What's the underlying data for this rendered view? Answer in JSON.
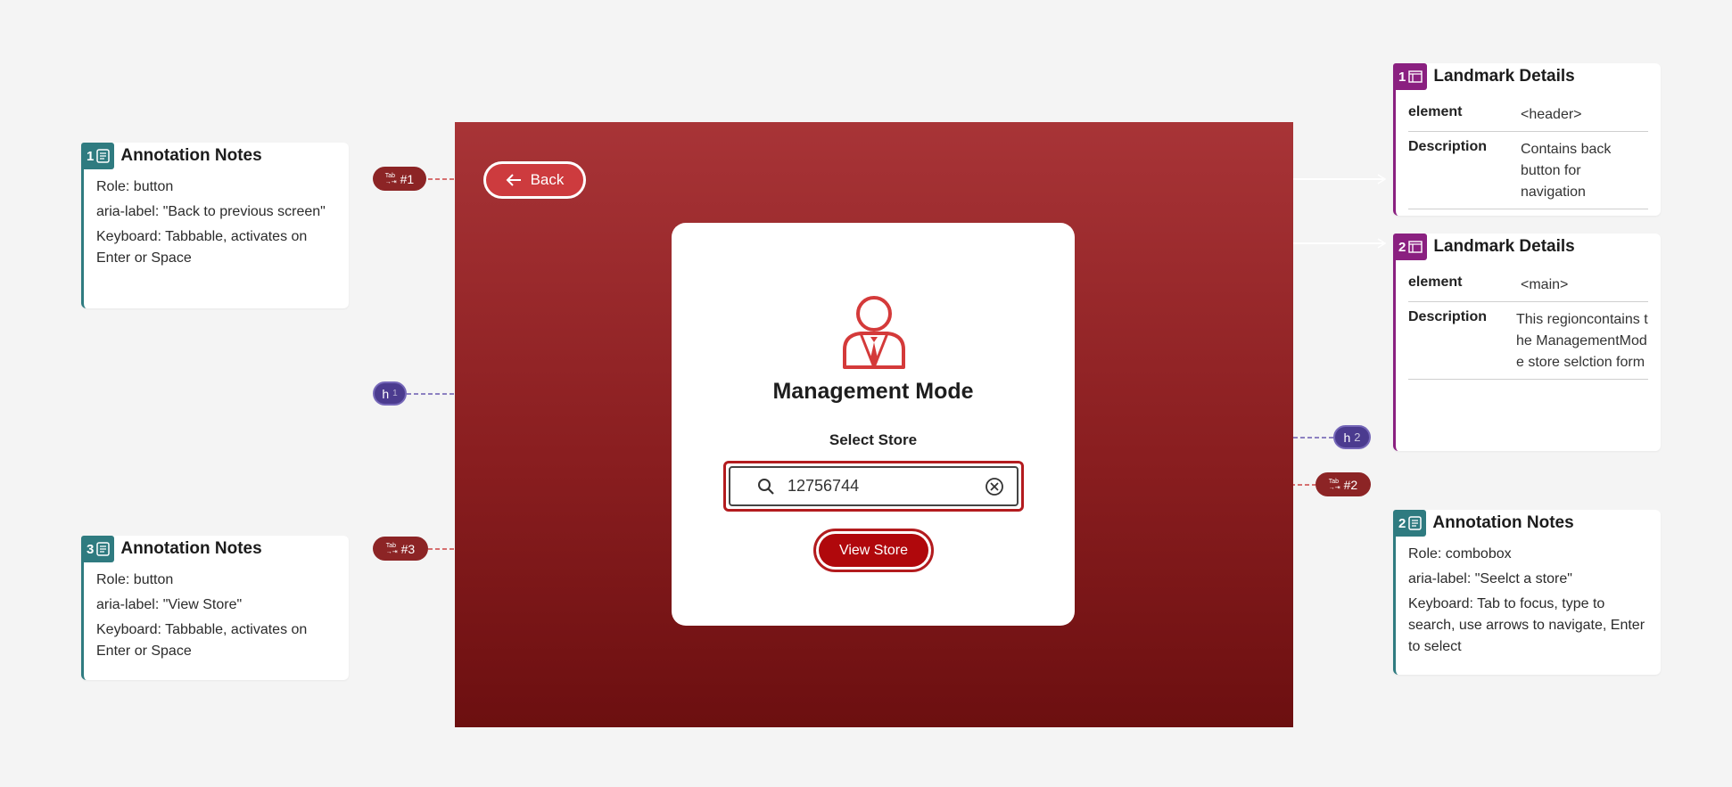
{
  "notes": [
    {
      "number": "1",
      "title": "Annotation Notes",
      "role": "Role: button",
      "aria": "aria-label: \"Back to previous screen\"",
      "keyboard": "Keyboard: Tabbable, activates on Enter or Space"
    },
    {
      "number": "3",
      "title": "Annotation Notes",
      "role": "Role: button",
      "aria": "aria-label: \"View Store\"",
      "keyboard": "Keyboard: Tabbable, activates on Enter or Space"
    },
    {
      "number": "2",
      "title": "Annotation Notes",
      "role": "Role: combobox",
      "aria": "aria-label: \"Seelct a store\"",
      "keyboard": "Keyboard: Tab to focus, type to search, use arrows to navigate, Enter to select"
    }
  ],
  "landmarks": [
    {
      "number": "1",
      "title": "Landmark Details",
      "element_key": "element",
      "element_val": "<header>",
      "desc_key": "Description",
      "desc_val": "Contains back button for navigation"
    },
    {
      "number": "2",
      "title": "Landmark Details",
      "element_key": "element",
      "element_val": "<main>",
      "desc_key": "Description",
      "desc_val": "This regioncontains the ManagementMode store selction form"
    }
  ],
  "app": {
    "back_label": "Back",
    "heading": "Management Mode",
    "select_label": "Select Store",
    "search_value": "12756744",
    "view_button": "View Store"
  },
  "markers": {
    "tab_word": "Tab",
    "tab1": "#1",
    "tab2": "#2",
    "tab3": "#3",
    "h1": "h",
    "h1_level": "1",
    "h2": "h",
    "h2_level": "2"
  },
  "colors": {
    "screen_gradient": [
      "#a83437",
      "#6c0f10"
    ],
    "accent_red": "#b0080c",
    "note_teal": "#2f7b80",
    "landmark_purple": "#8a2080",
    "heading_marker": "#4b3b8f"
  },
  "icons": [
    "arrow-left-icon",
    "manager-person-icon",
    "search-icon",
    "clear-circle-icon",
    "note-icon",
    "landmark-icon",
    "tab-key-icon"
  ]
}
